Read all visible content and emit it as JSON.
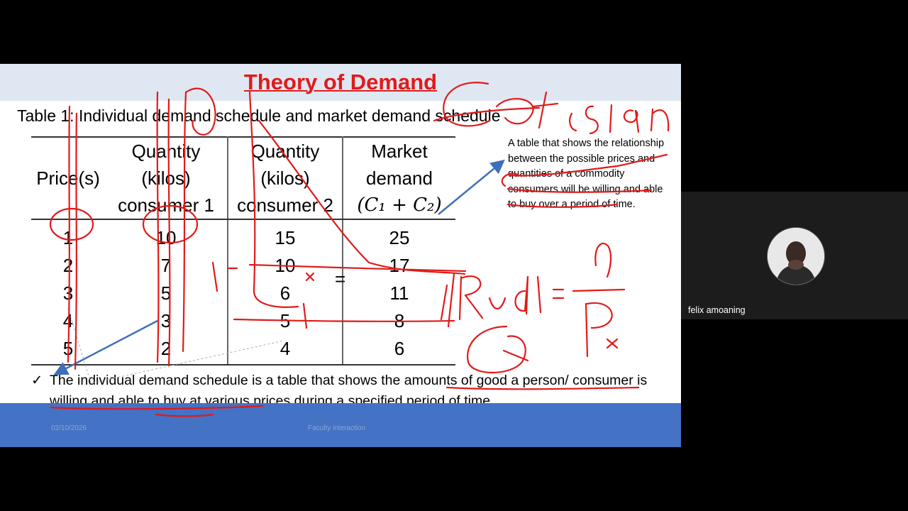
{
  "slide": {
    "title": "Theory of Demand",
    "table_caption": "Table 1: Individual demand schedule and market demand schedule",
    "table": {
      "headers": {
        "price": [
          "Price(s)"
        ],
        "consumer1": [
          "Quantity",
          "(kilos)",
          "consumer 1"
        ],
        "consumer2": [
          "Quantity",
          "(kilos)",
          "consumer 2"
        ],
        "market": [
          "Market",
          "demand",
          "(C₁ + C₂)"
        ]
      },
      "rows": [
        [
          "1",
          "10",
          "15",
          "25"
        ],
        [
          "2",
          "7",
          "10",
          "17"
        ],
        [
          "3",
          "5",
          "6",
          "11"
        ],
        [
          "4",
          "3",
          "5",
          "8"
        ],
        [
          "5",
          "2",
          "4",
          "6"
        ]
      ]
    },
    "definition_note": "A table that shows the relationship between the possible prices and quantities of a commodity consumers will be willing and able to buy over a period of time.",
    "bullet": {
      "mark": "✓",
      "text": "The individual demand schedule is a table that shows the amounts of good a person/ consumer is willing and able to buy at various prices during a specified period of time."
    },
    "footer": {
      "date": "02/10/2026",
      "center": "Faculty interaction"
    },
    "colors": {
      "title": "#e21a1a",
      "title_band": "#dfe8f2",
      "footer_band": "#4472c4",
      "ink": "#e21a1a",
      "arrow": "#3e6fba"
    }
  },
  "participant": {
    "name": "felix amoaning"
  }
}
